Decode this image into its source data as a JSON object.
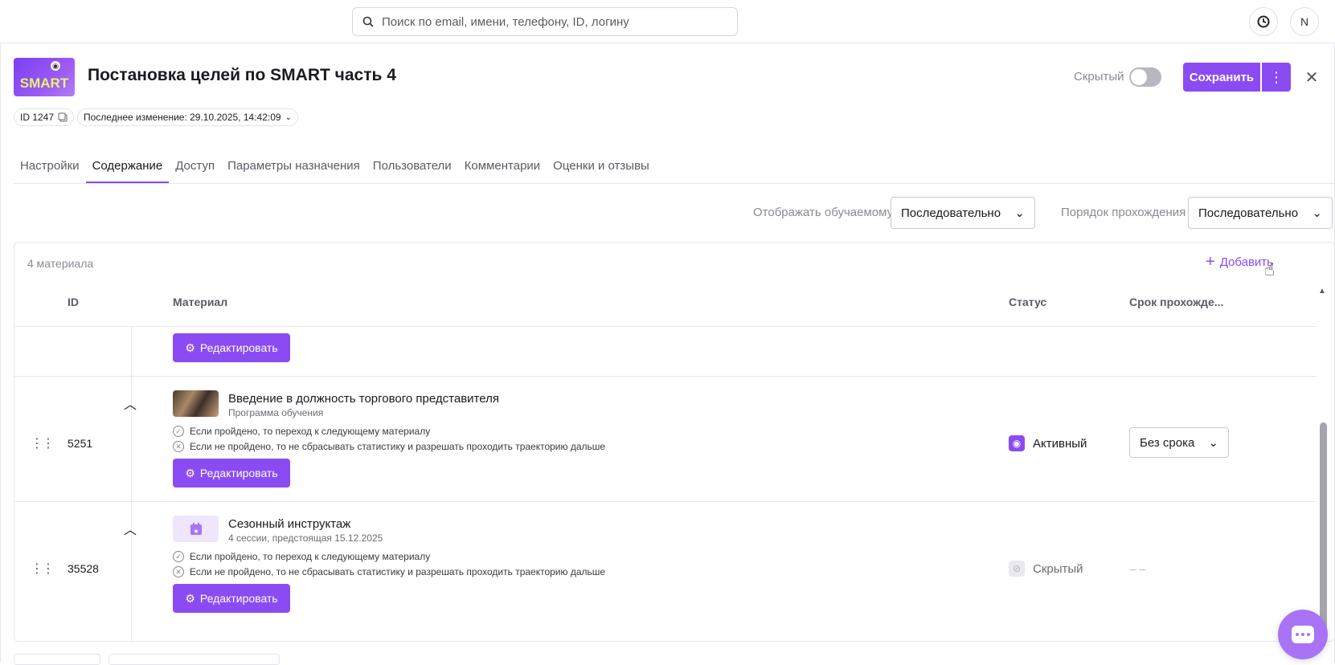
{
  "header": {
    "search_placeholder": "Поиск по email, имени, телефону, ID, логину",
    "avatar_letter": "N"
  },
  "course": {
    "logo_text": "SMART",
    "title": "Постановка целей по SMART часть 4",
    "hidden_label": "Скрытый",
    "save_label": "Сохранить",
    "id_label": "ID 1247",
    "last_modified": "Последнее изменение: 29.10.2025, 14:42:09"
  },
  "tabs": [
    {
      "label": "Настройки"
    },
    {
      "label": "Содержание"
    },
    {
      "label": "Доступ"
    },
    {
      "label": "Параметры назначения"
    },
    {
      "label": "Пользователи"
    },
    {
      "label": "Комментарии"
    },
    {
      "label": "Оценки и отзывы"
    }
  ],
  "filters": {
    "display_label": "Отображать обучаемому",
    "display_value": "Последовательно",
    "order_label": "Порядок прохождения",
    "order_value": "Последовательно"
  },
  "materials": {
    "count_label": "4 материала",
    "add_label": "Добавить",
    "columns": {
      "id": "ID",
      "material": "Материал",
      "status": "Статус",
      "term": "Срок прохожде..."
    },
    "edit_label": "Редактировать",
    "rows": [
      {
        "id": "5251",
        "title": "Введение в должность торгового представителя",
        "subtitle": "Программа обучения",
        "rule_pass": "Если пройдено, то переход к следующему материалу",
        "rule_fail": "Если не пройдено, то не сбрасывать статистику и разрешать проходить траекторию дальше",
        "status": "Активный",
        "term": "Без срока"
      },
      {
        "id": "35528",
        "title": "Сезонный инструктаж",
        "subtitle": "4 сессии, предстоящая 15.12.2025",
        "rule_pass": "Если пройдено, то переход к следующему материалу",
        "rule_fail": "Если не пройдено, то не сбрасывать статистику и разрешать проходить траекторию дальше",
        "status": "Скрытый",
        "term": "– –"
      }
    ]
  },
  "colors": {
    "accent": "#8b4bf2",
    "chat": "#a874f5"
  }
}
